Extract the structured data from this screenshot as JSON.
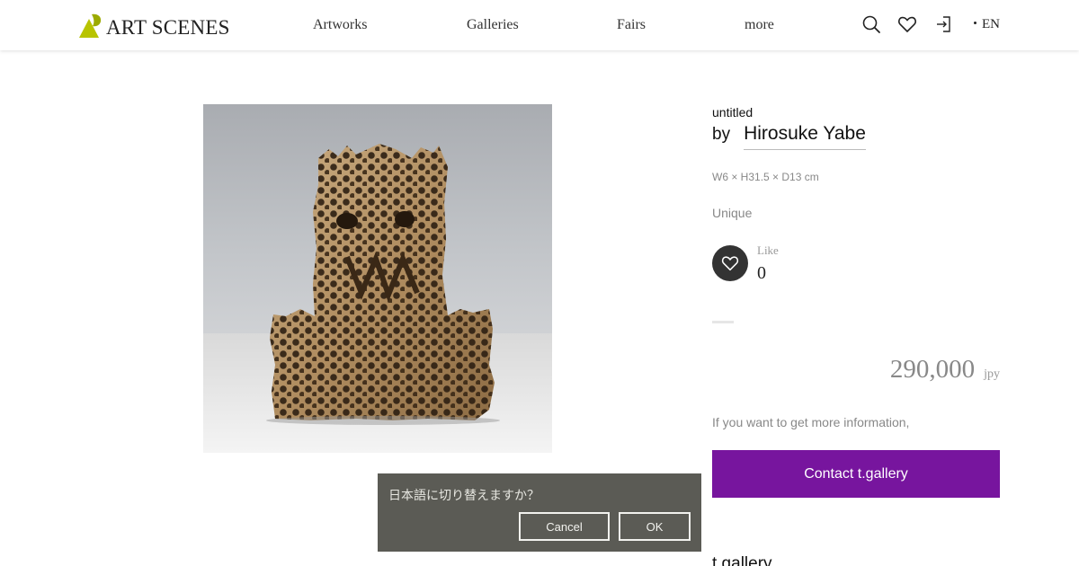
{
  "header": {
    "logo_text": "ART SCENES",
    "nav": [
      "Artworks",
      "Galleries",
      "Fairs",
      "more"
    ],
    "language": "EN",
    "icons": [
      "search-icon",
      "heart-icon",
      "login-icon"
    ]
  },
  "artwork": {
    "title": "untitled",
    "by_label": "by",
    "artist": "Hirosuke Yabe",
    "dimensions": "W6 × H31.5 × D13 cm",
    "edition": "Unique",
    "like_label": "Like",
    "like_count": "0",
    "price": "290,000",
    "currency": "jpy",
    "info_text": "If you want to get more information,",
    "contact_label": "Contact t.gallery",
    "gallery_name": "t.gallery"
  },
  "dialog": {
    "message": "日本語に切り替えますか？",
    "cancel_label": "Cancel",
    "ok_label": "OK"
  },
  "colors": {
    "accent_purple": "#77159e",
    "logo_green": "#b8c400",
    "dialog_bg": "#5b5b55"
  }
}
